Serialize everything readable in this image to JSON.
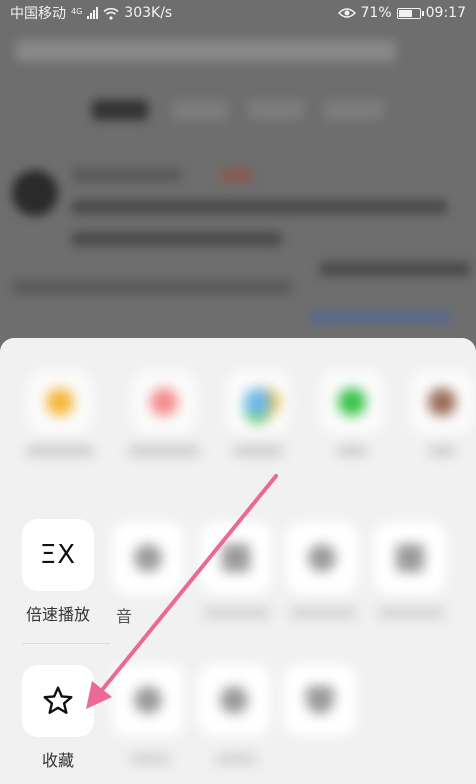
{
  "status_bar": {
    "carrier": "中国移动",
    "network": "4G",
    "speed": "303K/s",
    "battery": "71%",
    "battery_level": 0.71,
    "time": "09:17"
  },
  "menu": {
    "speed_play_icon": "ΞX",
    "speed_play_label": "倍速播放",
    "partial_label": "音",
    "favorite_label": "收藏"
  },
  "annotation": {
    "color": "#ea6a93"
  }
}
